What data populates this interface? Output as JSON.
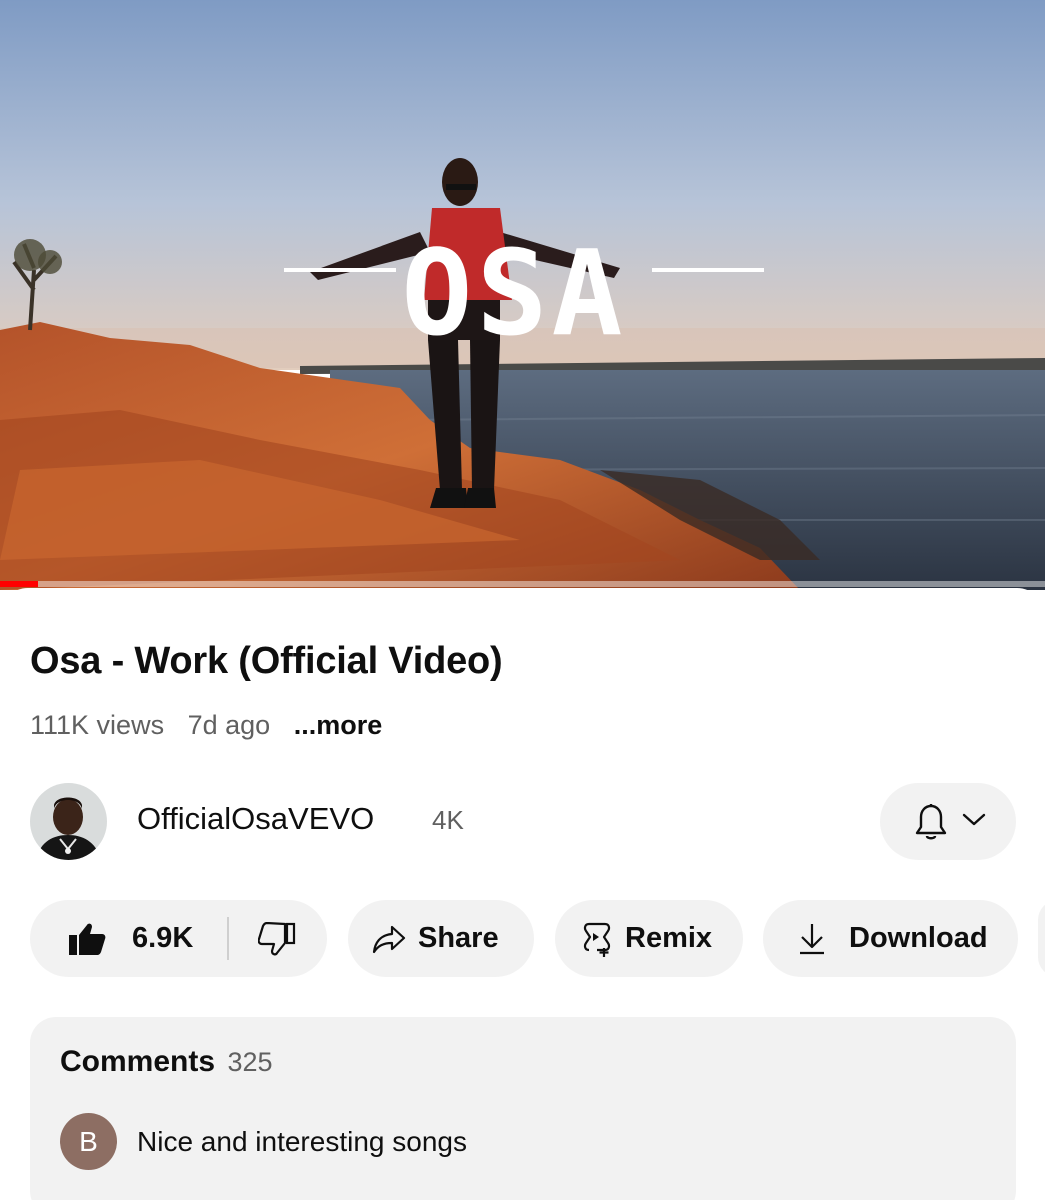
{
  "video": {
    "overlay_title": "OSA",
    "progress": 0.036,
    "progress_color": "#ff0000"
  },
  "details": {
    "title": "Osa - Work (Official Video)",
    "views": "111K views",
    "age": "7d ago",
    "more_label": "...more"
  },
  "channel": {
    "name": "OfficialOsaVEVO",
    "subscribers": "4K",
    "bell_icon": "bell-icon",
    "chevron_icon": "chevron-down-icon"
  },
  "actions": {
    "like_count": "6.9K",
    "share_label": "Share",
    "remix_label": "Remix",
    "download_label": "Download"
  },
  "comments": {
    "title": "Comments",
    "count": "325",
    "top_comment": {
      "avatar_initial": "B",
      "avatar_color": "#8d6e63",
      "text": "Nice and interesting songs"
    }
  },
  "colors": {
    "pill_bg": "#f2f2f2",
    "secondary_text": "#606060",
    "primary_text": "#0f0f0f"
  }
}
